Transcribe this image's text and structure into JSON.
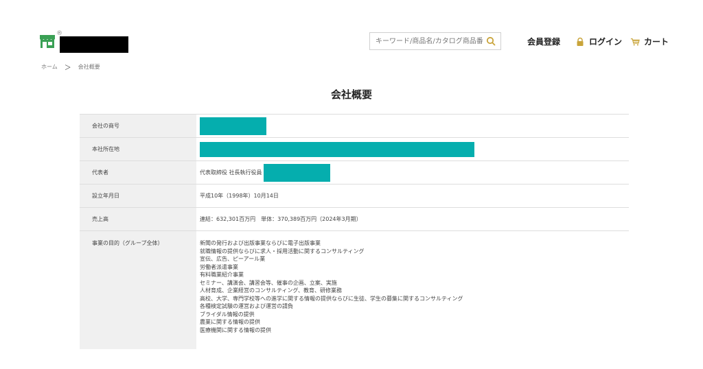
{
  "header": {
    "logo": {
      "registered_mark": "®"
    },
    "search": {
      "placeholder": "キーワード/商品名/カタログ商品番"
    },
    "nav": {
      "register": "会員登録",
      "login": "ログイン",
      "cart": "カート"
    }
  },
  "breadcrumb": {
    "home": "ホーム",
    "separator": "＞",
    "current": "会社概要"
  },
  "page": {
    "title": "会社概要"
  },
  "company_info": {
    "rows": [
      {
        "label": "会社の商号",
        "value": ""
      },
      {
        "label": "本社所在地",
        "value": ""
      },
      {
        "label": "代表者",
        "value": "代表取締役 社長執行役員"
      },
      {
        "label": "設立年月日",
        "value": "平成10年（1998年）10月14日"
      },
      {
        "label": "売上高",
        "value": "連結：632,301百万円　単体：370,389百万円（2024年3月期）"
      },
      {
        "label": "事業の目的（グループ全体）",
        "value": ""
      }
    ],
    "purposes": [
      "新聞の発行および出版事業ならびに電子出版事業",
      "就職情報の提供ならびに求人・採用活動に関するコンサルティング",
      "宣伝、広告、ピーアール業",
      "労働者派遣事業",
      "有料職業紹介事業",
      "セミナー、講演会、講習会等、催事の企画、立案、実施",
      "人材育成、企業経営のコンサルティング、教育、研修業務",
      "高校、大学、専門学校等への進学に関する情報の提供ならびに生徒、学生の募集に関するコンサルティング",
      "各種検定試験の運営および運営の請負",
      "ブライダル情報の提供",
      "農業に関する情報の提供",
      "医療機関に関する情報の提供"
    ]
  },
  "colors": {
    "redaction": "#05aeae",
    "logo_green": "#3aa055",
    "nav_icon_gold": "#c9a43a",
    "label_bg": "#f0f0f0"
  },
  "icons": {
    "logo": "storefront-icon",
    "search": "search-icon",
    "login": "lock-icon",
    "cart": "cart-icon"
  }
}
